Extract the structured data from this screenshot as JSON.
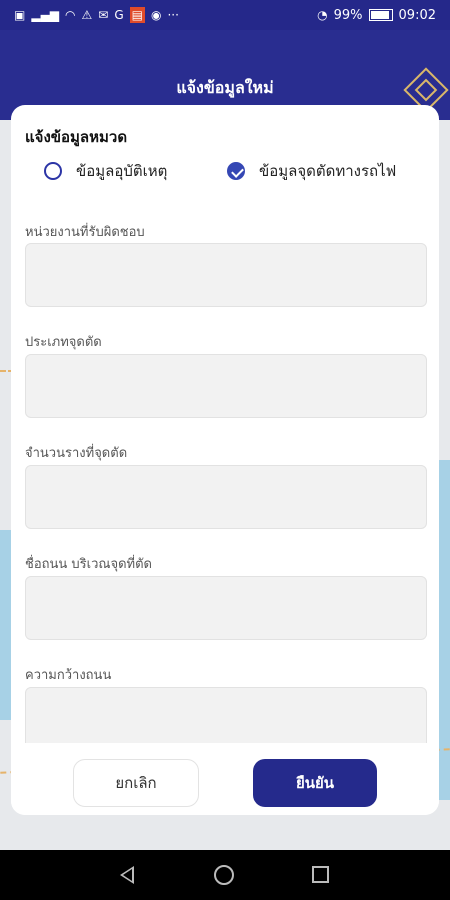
{
  "statusbar": {
    "left_icons": [
      "app-icon",
      "signal-icon",
      "wifi-icon",
      "warning-icon",
      "mail-icon",
      "g-icon",
      "app-icon-red",
      "chat-icon",
      "more-icon"
    ],
    "battery": "99%",
    "time": "09:02"
  },
  "appbar": {
    "title": "แจ้งข้อมูลใหม่"
  },
  "form": {
    "title": "แจ้งข้อมูลหมวด",
    "options": [
      {
        "label": "ข้อมูลอุบัติเหตุ",
        "checked": false
      },
      {
        "label": "ข้อมูลจุดตัดทางรถไฟ",
        "checked": true
      }
    ],
    "fields": [
      {
        "label": "หน่วยงานที่รับผิดชอบ",
        "value": ""
      },
      {
        "label": "ประเภทจุดตัด",
        "value": ""
      },
      {
        "label": "จำนวนรางที่จุดตัด",
        "value": ""
      },
      {
        "label": "ชื่อถนน บริเวณจุดที่ตัด",
        "value": ""
      },
      {
        "label": "ความกว้างถนน",
        "value": ""
      }
    ]
  },
  "buttons": {
    "cancel": "ยกเลิก",
    "confirm": "ยืนยัน"
  },
  "colors": {
    "primary": "#292d90",
    "accent": "#3547b4"
  }
}
